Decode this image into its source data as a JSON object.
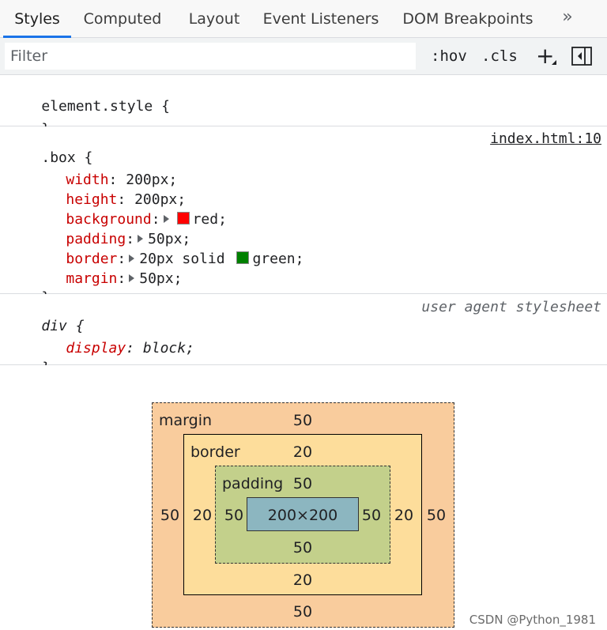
{
  "tabs": [
    {
      "label": "Styles",
      "active": true
    },
    {
      "label": "Computed"
    },
    {
      "label": "Layout"
    },
    {
      "label": "Event Listeners"
    },
    {
      "label": "DOM Breakpoints"
    }
  ],
  "tab_more_glyph": "»",
  "toolbar": {
    "filter_placeholder": "Filter",
    "hov_label": ":hov",
    "cls_label": ".cls",
    "plus_label": "+"
  },
  "rules": {
    "element_style": {
      "selector": "element.style",
      "open": " {",
      "close": "}"
    },
    "box": {
      "selector": ".box",
      "open": " {",
      "close": "}",
      "source": "index.html:10",
      "decls": [
        {
          "prop": "width",
          "value": "200px;"
        },
        {
          "prop": "height",
          "value": "200px;"
        },
        {
          "prop": "background",
          "value": "red;",
          "swatch": "#ff0000"
        },
        {
          "prop": "padding",
          "value": "50px;"
        },
        {
          "prop": "border",
          "value_pre": "20px solid ",
          "value": "green;",
          "swatch": "#008000"
        },
        {
          "prop": "margin",
          "value": "50px;"
        }
      ]
    },
    "div": {
      "selector": "div",
      "open": " {",
      "close": "}",
      "source": "user agent stylesheet",
      "decls": [
        {
          "prop": "display",
          "value": "block;"
        }
      ]
    }
  },
  "box_model": {
    "margin": {
      "label": "margin",
      "top": "50",
      "right": "50",
      "bottom": "50",
      "left": "50"
    },
    "border": {
      "label": "border",
      "top": "20",
      "right": "20",
      "bottom": "20",
      "left": "20"
    },
    "padding": {
      "label": "padding",
      "top": "50",
      "right": "50",
      "bottom": "50",
      "left": "50"
    },
    "content": "200×200"
  },
  "colors": {
    "accent": "#1a73e8",
    "property": "#c80000",
    "margin": "#f9cc9d",
    "border": "#fddd9b",
    "padding": "#c3d08b",
    "content": "#8cb6c0"
  },
  "watermark": "CSDN @Python_1981"
}
